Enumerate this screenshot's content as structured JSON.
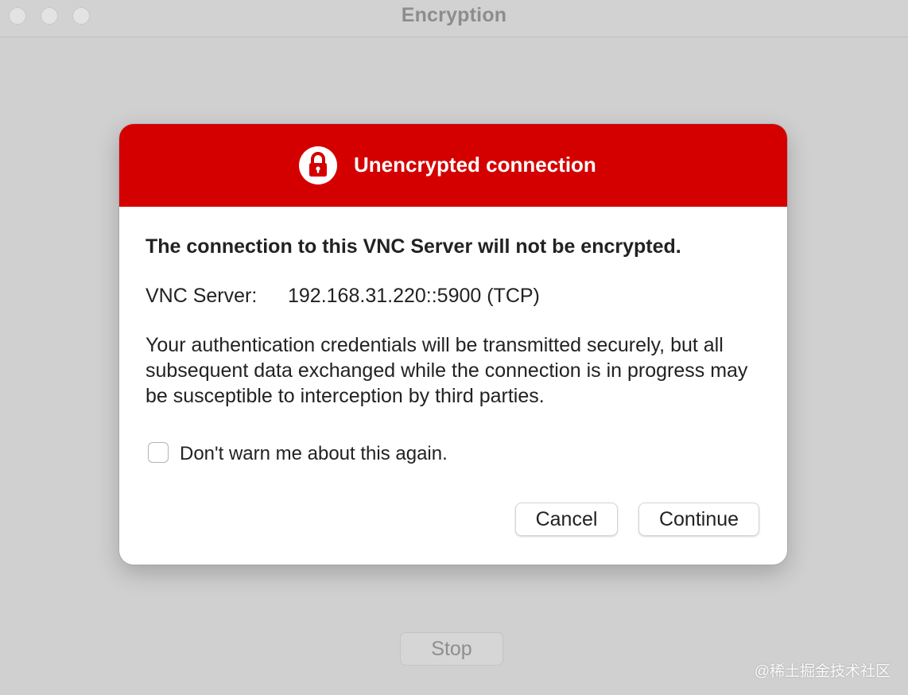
{
  "window": {
    "title": "Encryption",
    "stop_label": "Stop"
  },
  "dialog": {
    "header_title": "Unencrypted connection",
    "header_icon": "lock-icon",
    "accent_color": "#d40000",
    "headline": "The connection to this VNC Server will not be encrypted.",
    "server_label": "VNC Server:",
    "server_value": "192.168.31.220::5900 (TCP)",
    "description": "Your authentication credentials will be transmitted securely, but all subsequent data exchanged while the connection is in progress may be susceptible to interception by third parties.",
    "checkbox_label": "Don't warn me about this again.",
    "checkbox_checked": false,
    "cancel_label": "Cancel",
    "continue_label": "Continue"
  },
  "watermark": "@稀土掘金技术社区"
}
